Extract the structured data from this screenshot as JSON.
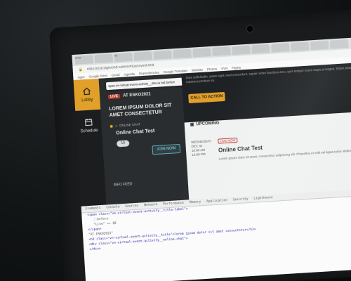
{
  "browser": {
    "tabs": [
      "Chat",
      "",
      "Sp",
      "",
      "",
      "",
      "",
      "",
      "",
      "",
      "",
      "",
      "",
      "",
      "",
      ""
    ],
    "url": "esko.local.signvond.ca/en/virtual-event-test",
    "bookmarks": [
      "Apps",
      "Google Drive",
      "Gmail",
      "Agenda",
      "Dependencies",
      "Google Translate",
      "Website",
      "Photos",
      "SVN",
      "Figma"
    ]
  },
  "sidebar": {
    "items": [
      {
        "label": "Lobby",
        "icon": "home-icon",
        "active": true
      },
      {
        "label": "Schedule",
        "icon": "calendar-icon",
        "active": false
      }
    ]
  },
  "left_panel": {
    "tooltip": "span.vn-virtual-event-activity__title-la bel.before",
    "live_badge": "LIVE",
    "live_text": "AT ESKO2021",
    "event_title": "LOREM IPSUM DOLOR SIT AMET CONSECTETUR",
    "online_label": "ONLINE CHAT",
    "chat_name": "Online Chat Test",
    "count": "10",
    "join_label": "JOIN NOW",
    "info_feed": "INFO FEED"
  },
  "main": {
    "intro": "Duis sollicitudin, quam eget viverra tincidunt, sapien enim faucibus arcu, quis tempor lorem turpis a magna. Etiam pharetra at mauris vel, maximus pretium ex.",
    "cta_label": "CALL TO ACTION",
    "upcoming_label": "UPCOMING",
    "date_lines": [
      "WEDNESDAY",
      "DEC 31",
      "10:00 AM",
      "12:00 PM"
    ],
    "live_tag": "LIVE NOW",
    "chat_title": "Online Chat Test",
    "lorem": "Lorem ipsum dolor sit amet, consectetur adipiscing elit. Phasellus et velit vel ligula tortor eleifend."
  },
  "devtools": {
    "tabs": [
      "Elements",
      "Console",
      "Sources",
      "Network",
      "Performance",
      "Memory",
      "Application",
      "Security",
      "Lighthouse"
    ],
    "lines": [
      "<span class=\"vn-virtual-event-activity__title-label\">",
      "::before",
      "\"Live\" == $0",
      "</span>",
      "\"AT ESKO2021\"",
      "<h3 class=\"vn-virtual-event-activity__title\">lorem ipsum dolor sit amet consectetur</h3>",
      "<div class=\"vn-virtual-event-activity__online-chat\">",
      "</div>"
    ]
  },
  "colors": {
    "accent": "#e0a02a",
    "live": "#c0392b",
    "join": "#59aebd"
  }
}
